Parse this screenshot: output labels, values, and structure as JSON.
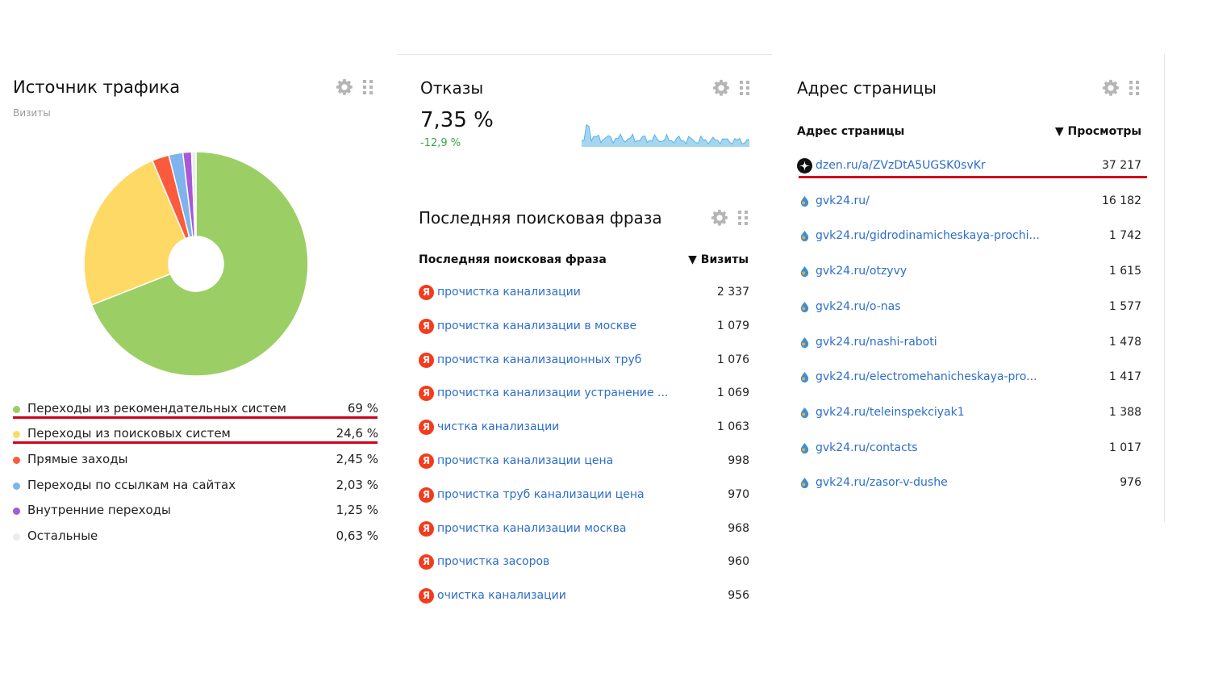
{
  "traffic": {
    "title": "Источник трафика",
    "subtitle": "Визиты",
    "icons": {
      "settings": "gear-icon",
      "drag": "grip-icon"
    },
    "legend": [
      {
        "label": "Переходы из рекомендательных систем",
        "value": "69 %",
        "share": 69,
        "color": "#9bcf65"
      },
      {
        "label": "Переходы из поисковых систем",
        "value": "24,6 %",
        "share": 24.6,
        "color": "#ffd966"
      },
      {
        "label": "Прямые заходы",
        "value": "2,45 %",
        "share": 2.45,
        "color": "#fb5b3d"
      },
      {
        "label": "Переходы по ссылкам на сайтах",
        "value": "2,03 %",
        "share": 2.03,
        "color": "#7eb3ee"
      },
      {
        "label": "Внутренние переходы",
        "value": "1,25 %",
        "share": 1.25,
        "color": "#a75ad4"
      },
      {
        "label": "Остальные",
        "value": "0,63 %",
        "share": 0.63,
        "color": "#ececec"
      }
    ]
  },
  "bounces": {
    "title": "Отказы",
    "value": "7,35 %",
    "delta": "-12,9 %",
    "delta_color": "#3aa74a",
    "spark_color": "#5ab2e6"
  },
  "search": {
    "title": "Последняя поисковая фраза",
    "col_phrase": "Последняя поисковая фраза",
    "col_visits": "▼ Визиты",
    "rows": [
      {
        "phrase": "прочистка канализации",
        "visits": "2 337"
      },
      {
        "phrase": "прочистка канализации в москве",
        "visits": "1 079"
      },
      {
        "phrase": "прочистка канализационных труб",
        "visits": "1 076"
      },
      {
        "phrase": "прочистка канализации устранение ...",
        "visits": "1 069"
      },
      {
        "phrase": "чистка канализации",
        "visits": "1 063"
      },
      {
        "phrase": "прочистка канализации цена",
        "visits": "998"
      },
      {
        "phrase": "прочистка труб канализации цена",
        "visits": "970"
      },
      {
        "phrase": "прочистка канализации москва",
        "visits": "968"
      },
      {
        "phrase": "прочистка засоров",
        "visits": "960"
      },
      {
        "phrase": "очистка канализации",
        "visits": "956"
      }
    ],
    "engine_icon_letter": "Я"
  },
  "pages": {
    "title": "Адрес страницы",
    "col_url": "Адрес страницы",
    "col_views": "▼ Просмотры",
    "rows": [
      {
        "url": "dzen.ru/a/ZVzDtA5UGSK0svKr",
        "views": "37 217",
        "icon": "dzen-icon"
      },
      {
        "url": "gvk24.ru/",
        "views": "16 182",
        "icon": "site-favicon-icon"
      },
      {
        "url": "gvk24.ru/gidrodinamicheskaya-prochi...",
        "views": "1 742",
        "icon": "site-favicon-icon"
      },
      {
        "url": "gvk24.ru/otzyvy",
        "views": "1 615",
        "icon": "site-favicon-icon"
      },
      {
        "url": "gvk24.ru/o-nas",
        "views": "1 577",
        "icon": "site-favicon-icon"
      },
      {
        "url": "gvk24.ru/nashi-raboti",
        "views": "1 478",
        "icon": "site-favicon-icon"
      },
      {
        "url": "gvk24.ru/electromehanicheskaya-pro...",
        "views": "1 417",
        "icon": "site-favicon-icon"
      },
      {
        "url": "gvk24.ru/teleinspekciyak1",
        "views": "1 388",
        "icon": "site-favicon-icon"
      },
      {
        "url": "gvk24.ru/contacts",
        "views": "1 017",
        "icon": "site-favicon-icon"
      },
      {
        "url": "gvk24.ru/zasor-v-dushe",
        "views": "976",
        "icon": "site-favicon-icon"
      }
    ]
  },
  "highlight_color": "#d0021b"
}
